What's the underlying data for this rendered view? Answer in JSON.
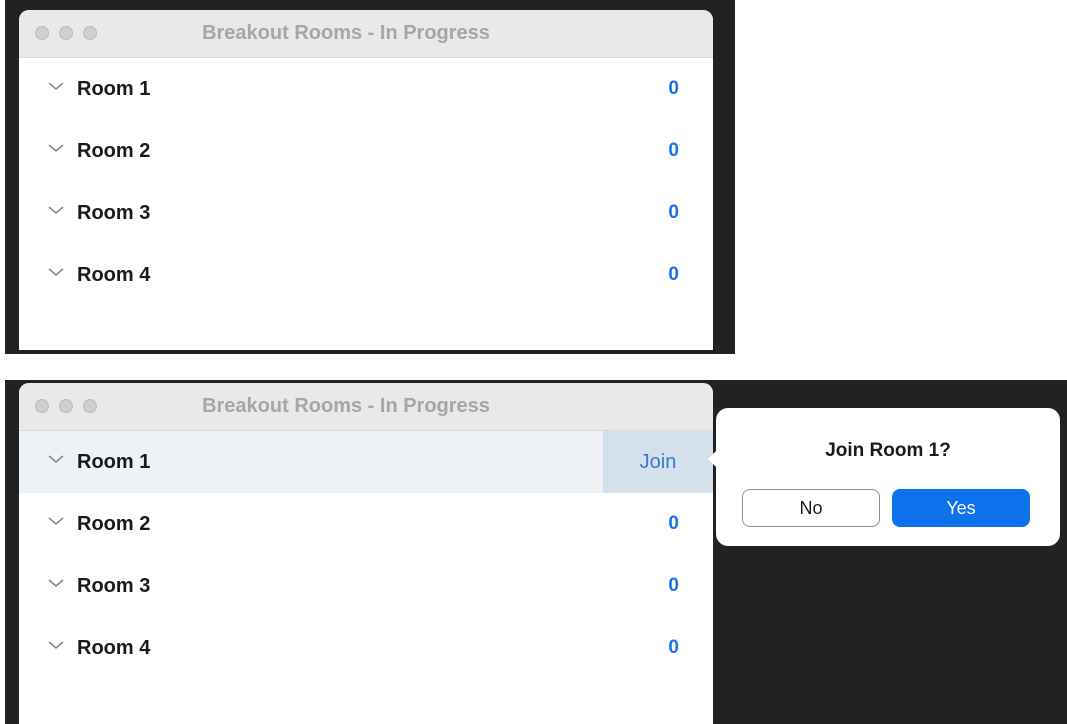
{
  "top_window": {
    "title": "Breakout Rooms - In Progress",
    "rooms": [
      {
        "name": "Room 1",
        "count": "0"
      },
      {
        "name": "Room 2",
        "count": "0"
      },
      {
        "name": "Room 3",
        "count": "0"
      },
      {
        "name": "Room 4",
        "count": "0"
      }
    ]
  },
  "bottom_window": {
    "title": "Breakout Rooms - In Progress",
    "rooms": [
      {
        "name": "Room 1",
        "action": "Join"
      },
      {
        "name": "Room 2",
        "count": "0"
      },
      {
        "name": "Room 3",
        "count": "0"
      },
      {
        "name": "Room 4",
        "count": "0"
      }
    ]
  },
  "popover": {
    "question": "Join Room 1?",
    "no_label": "No",
    "yes_label": "Yes"
  },
  "icons": {
    "window_controls": [
      "close-icon",
      "minimize-icon",
      "zoom-icon"
    ],
    "room_toggle": "chevron-down-icon"
  },
  "colors": {
    "accent": "#0e72ed",
    "count_text": "#1a73e8",
    "join_highlight": "#d5e0ed",
    "backdrop": "#222222"
  }
}
